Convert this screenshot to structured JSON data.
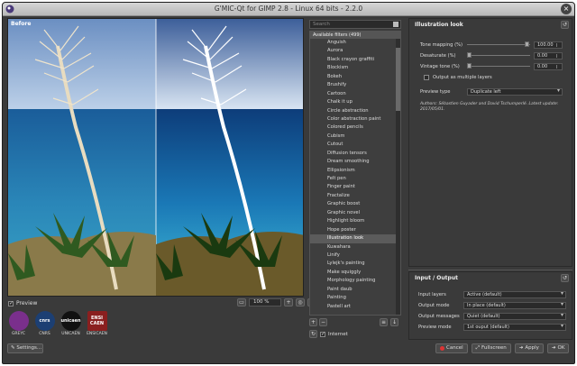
{
  "window": {
    "title": "G'MIC-Qt for GIMP 2.8 - Linux 64 bits - 2.2.0"
  },
  "preview": {
    "label": "Before",
    "checkbox_label": "Preview",
    "zoom_value": "100 %"
  },
  "logos": [
    {
      "caption": "GREYC",
      "color": "#7a2f8c",
      "mark": ""
    },
    {
      "caption": "CNRS",
      "color": "#1c3f73",
      "mark": "cnrs"
    },
    {
      "caption": "UNICAEN",
      "color": "#111111",
      "mark": "unicaen"
    },
    {
      "caption": "ENSICAEN",
      "color": "#8a1f1f",
      "mark": "ENSI CAEN"
    }
  ],
  "settings_button": "Settings...",
  "filters": {
    "search_placeholder": "Search",
    "header": "Available filters (499)",
    "items": [
      "Anguish",
      "Aurora",
      "Black crayon graffiti",
      "Blockism",
      "Bokeh",
      "Brushify",
      "Cartoon",
      "Chalk it up",
      "Circle abstraction",
      "Color abstraction paint",
      "Colored pencils",
      "Cubism",
      "Cutout",
      "Diffusion tensors",
      "Dream smoothing",
      "Ellipsionism",
      "Felt pen",
      "Finger paint",
      "Fractalize",
      "Graphic boost",
      "Graphic novel",
      "Highlight bloom",
      "Hope poster",
      "Illustration look",
      "Kuwahara",
      "Linify",
      "Lylejk's painting",
      "Make squiggly",
      "Morphology painting",
      "Paint daub",
      "Painting",
      "Pastell art"
    ],
    "selected_index": 23,
    "internet_label": "Internet"
  },
  "params": {
    "title": "Illustration look",
    "sliders": [
      {
        "label": "Tone mapping (%)",
        "value": "100.00",
        "level": 1.0
      },
      {
        "label": "Desaturate (%)",
        "value": "0.00",
        "level": 0.0
      },
      {
        "label": "Vintage tone (%)",
        "value": "0.00",
        "level": 0.0
      }
    ],
    "output_multiple_label": "Output as multiple layers",
    "preview_type_label": "Preview type",
    "preview_type_value": "Duplicate left",
    "authors": "Authors: Sébastien Guyader and David Tschumperlé. Latest update: 2017/05/01."
  },
  "io": {
    "title": "Input / Output",
    "rows": [
      {
        "label": "Input layers",
        "value": "Active (default)"
      },
      {
        "label": "Output mode",
        "value": "In place (default)"
      },
      {
        "label": "Output messages",
        "value": "Quiet (default)"
      },
      {
        "label": "Preview mode",
        "value": "1st ouput (default)"
      }
    ]
  },
  "buttons": {
    "cancel": "Cancel",
    "fullscreen": "Fullscreen",
    "apply": "Apply",
    "ok": "OK"
  }
}
